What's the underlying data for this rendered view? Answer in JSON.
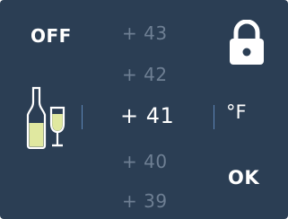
{
  "controls": {
    "off_label": "OFF",
    "ok_label": "OK",
    "unit_label": "°F",
    "lock_icon": "lock-icon",
    "wine_icon": "wine-bottle-glass-icon"
  },
  "temperature_picker": {
    "selected": "+ 41",
    "values": [
      "+ 43",
      "+ 42",
      "+ 41",
      "+ 40",
      "+ 39"
    ]
  },
  "colors": {
    "background": "#2b3e54",
    "text_primary": "#ffffff",
    "text_muted": "#6e7f93",
    "separator": "#5d86b8"
  }
}
